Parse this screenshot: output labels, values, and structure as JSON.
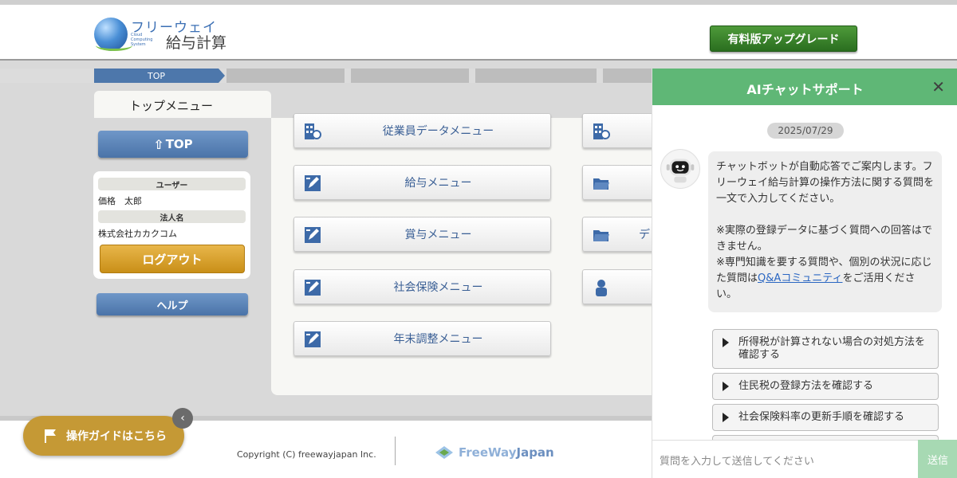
{
  "header": {
    "logo_name": "フリーウェイ",
    "logo_sub": "Cloud Computing System",
    "logo_main": "給与計算",
    "upgrade_label": "有料版アップグレード"
  },
  "breadcrumb": {
    "items": [
      "TOP"
    ]
  },
  "page": {
    "title": "トップメニュー"
  },
  "sidebar": {
    "top_label": "TOP",
    "user_label": "ユーザー",
    "user_name": "価格　太郎",
    "company_label": "法人名",
    "company_name": "株式会社カカクコム",
    "logout_label": "ログアウト",
    "help_label": "ヘルプ"
  },
  "menu": {
    "items": [
      {
        "label": "従業員データメニュー",
        "icon": "building-icon"
      },
      {
        "label": "給与メニュー",
        "icon": "pen-icon"
      },
      {
        "label": "賞与メニュー",
        "icon": "pen-icon"
      },
      {
        "label": "社会保険メニュー",
        "icon": "pen-icon"
      },
      {
        "label": "年末調整メニュー",
        "icon": "pen-icon"
      }
    ],
    "right_items": [
      {
        "label": "",
        "icon": "building-icon"
      },
      {
        "label": "",
        "icon": "folder-icon"
      },
      {
        "label": "デ",
        "icon": "folder-icon"
      },
      {
        "label": "",
        "icon": "person-icon"
      }
    ]
  },
  "guide": {
    "label": "操作ガイドはこちら"
  },
  "footer": {
    "copyright": "Copyright (C) freewayjapan Inc.",
    "brand_1": "FreeWay",
    "brand_2": "Japan"
  },
  "chat": {
    "title": "AIチャットサポート",
    "close_label": "✕",
    "date": "2025/07/29",
    "message": {
      "p1": "チャットボットが自動応答でご案内します。フリーウェイ給与計算の操作方法に関する質問を一文で入力してください。",
      "p2": "※実際の登録データに基づく質問への回答はできません。",
      "p3_before": "※専門知識を要する質問や、個別の状況に応じた質問は",
      "p3_link": "Q&Aコミュニティ",
      "p3_after": "をご活用ください。"
    },
    "suggestions": [
      "所得税が計算されない場合の対処方法を確認する",
      "住民税の登録方法を確認する",
      "社会保険料率の更新手順を確認する"
    ],
    "input_placeholder": "質問を入力して送信してください",
    "send_label": "送信"
  },
  "colors": {
    "brand_blue": "#4d77ab",
    "upgrade_green": "#3a8a2c",
    "chat_green": "#5fb776",
    "logout_gold": "#d9a12d",
    "guide_gold": "#c59935"
  }
}
